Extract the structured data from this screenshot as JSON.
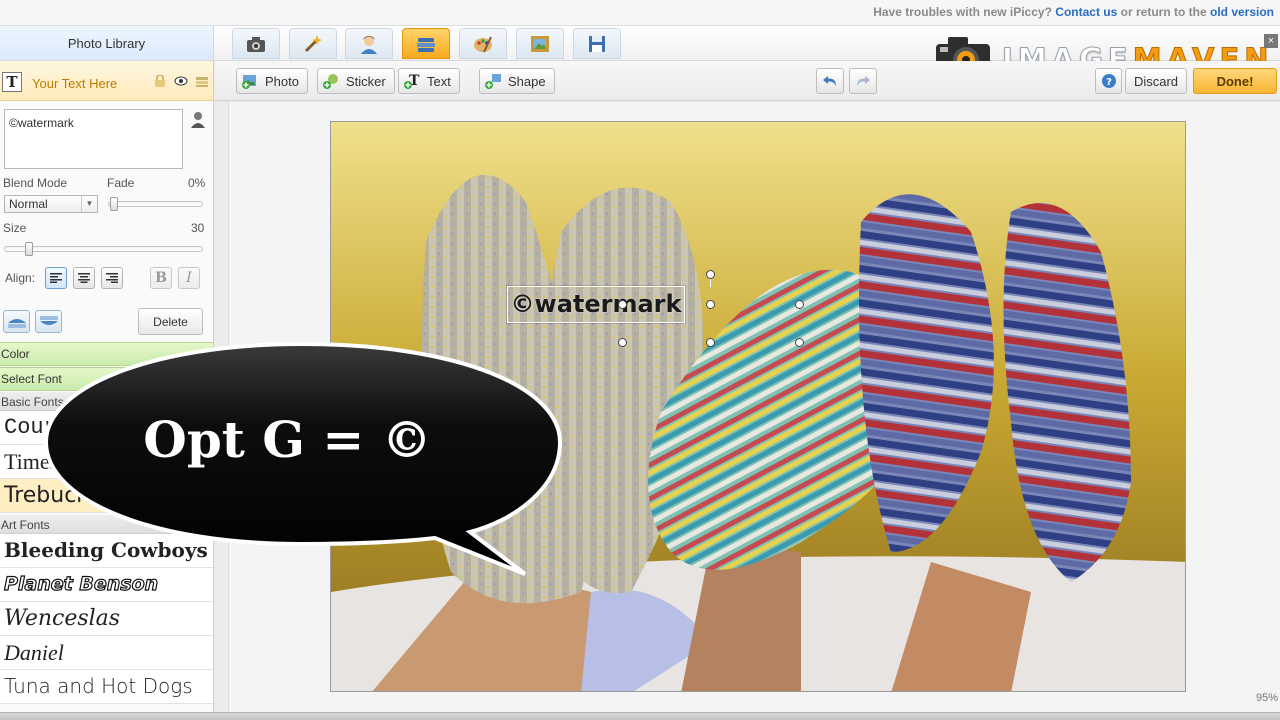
{
  "top_notice": {
    "prefix": "Have troubles with new iPiccy?",
    "contact_link": "Contact us",
    "middle": "or return to the",
    "old_version_link": "old version"
  },
  "logo": {
    "part1": "IMAGE",
    "part2": "MAVEN",
    "close_glyph": "×"
  },
  "tabs": {
    "photo_library": "Photo Library",
    "tool_icons": [
      "camera-icon",
      "magic-wand-icon",
      "person-icon",
      "text-layers-icon",
      "paint-icon",
      "frame-icon",
      "save-icon"
    ],
    "active_tab_index": 3
  },
  "text_panel": {
    "title": "Your Text Here",
    "text_value": "©watermark",
    "blend_mode_label": "Blend Mode",
    "blend_mode_value": "Normal",
    "fade_label": "Fade",
    "fade_value": "0%",
    "size_label": "Size",
    "size_value": "30",
    "align_label": "Align:",
    "bold_glyph": "B",
    "italic_glyph": "I",
    "delete_label": "Delete",
    "color_section": "Color",
    "select_font_section": "Select Font",
    "basic_fonts_label": "Basic Fonts",
    "basic_fonts": [
      "Courier",
      "Times",
      "Trebuchet"
    ],
    "art_fonts_label": "Art Fonts",
    "art_fonts": [
      "Bleeding Cowboys",
      "Planet Benson",
      "Wenceslas",
      "Daniel",
      "Tuna and Hot Dogs"
    ]
  },
  "toolbar": {
    "photo": "Photo",
    "sticker": "Sticker",
    "text": "Text",
    "shape": "Shape",
    "discard": "Discard",
    "done": "Done!"
  },
  "canvas": {
    "watermark_text": "©watermark",
    "zoom": "95%",
    "callout_text": "Opt G = ©"
  },
  "colors": {
    "accent_orange": "#f8b632",
    "section_green": "#c9ebac",
    "link_blue": "#2b6cc4"
  }
}
